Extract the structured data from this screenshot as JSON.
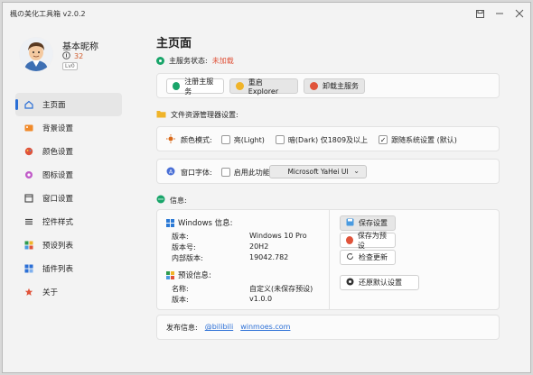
{
  "window": {
    "title": "楓の美化工具箱 v2.0.2"
  },
  "user": {
    "nickname": "基本昵称",
    "coins": "32",
    "level": "Lv0"
  },
  "nav": [
    {
      "label": "主页面",
      "icon": "home-icon",
      "color": "#2b6fd6"
    },
    {
      "label": "背景设置",
      "icon": "background-icon",
      "color": "#f08a2a"
    },
    {
      "label": "颜色设置",
      "icon": "palette-icon",
      "color": "#e0533a"
    },
    {
      "label": "图标设置",
      "icon": "icon-settings-icon",
      "color": "#c05ac8"
    },
    {
      "label": "窗口设置",
      "icon": "window-icon",
      "color": "#444444"
    },
    {
      "label": "控件样式",
      "icon": "controls-icon",
      "color": "#444444"
    },
    {
      "label": "预设列表",
      "icon": "preset-list-icon",
      "color": "#2e9b4e"
    },
    {
      "label": "插件列表",
      "icon": "plugin-icon",
      "color": "#2b6fd6"
    },
    {
      "label": "关于",
      "icon": "about-icon",
      "color": "#e0533a"
    }
  ],
  "main": {
    "title": "主页面",
    "service_label": "主服务状态:",
    "service_value": "未加载",
    "service_buttons": {
      "register": "注册主服务",
      "restart": "重启Explorer",
      "uninstall": "卸载主服务"
    },
    "explorer_label": "文件资源管理器设置:",
    "color_mode": {
      "label": "颜色模式:",
      "options": [
        "亮(Light)",
        "暗(Dark) 仅1809及以上",
        "跟随系统设置 (默认)"
      ]
    },
    "font": {
      "label": "窗口字体:",
      "enable_label": "启用此功能",
      "selected": "Microsoft YaHei UI"
    },
    "info_label": "信息:",
    "windows_info": {
      "heading": "Windows 信息:",
      "rows": [
        {
          "k": "版本:",
          "v": "Windows 10 Pro"
        },
        {
          "k": "版本号:",
          "v": "20H2"
        },
        {
          "k": "内部版本:",
          "v": "19042.782"
        }
      ]
    },
    "preset_info": {
      "heading": "预设信息:",
      "rows": [
        {
          "k": "名称:",
          "v": "自定义(未保存预设)"
        },
        {
          "k": "版本:",
          "v": "v1.0.0"
        }
      ]
    },
    "actions": {
      "save": "保存设置",
      "save_preset": "保存为预设",
      "check_update": "检查更新",
      "restore": "还原默认设置"
    },
    "publish": {
      "label": "发布信息:",
      "link1": "@bilibili",
      "link2": "winmoes.com"
    }
  }
}
